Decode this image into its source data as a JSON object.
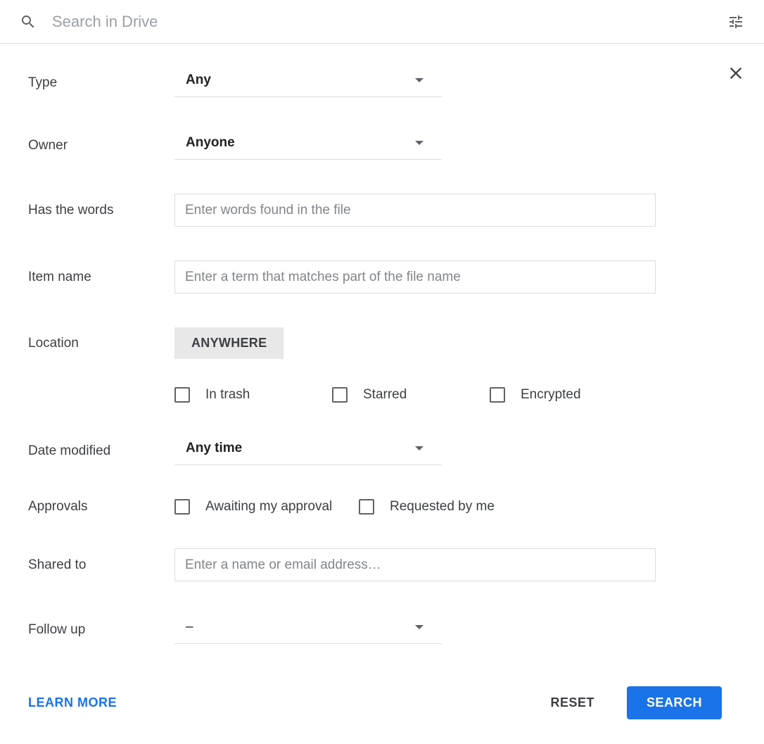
{
  "search": {
    "placeholder": "Search in Drive"
  },
  "form": {
    "type": {
      "label": "Type",
      "value": "Any"
    },
    "owner": {
      "label": "Owner",
      "value": "Anyone"
    },
    "hasWords": {
      "label": "Has the words",
      "placeholder": "Enter words found in the file"
    },
    "itemName": {
      "label": "Item name",
      "placeholder": "Enter a term that matches part of the file name"
    },
    "location": {
      "label": "Location",
      "chip": "ANYWHERE"
    },
    "locationChecks": {
      "inTrash": "In trash",
      "starred": "Starred",
      "encrypted": "Encrypted"
    },
    "dateModified": {
      "label": "Date modified",
      "value": "Any time"
    },
    "approvals": {
      "label": "Approvals",
      "awaiting": "Awaiting my approval",
      "requested": "Requested by me"
    },
    "sharedTo": {
      "label": "Shared to",
      "placeholder": "Enter a name or email address…"
    },
    "followUp": {
      "label": "Follow up",
      "value": "–"
    }
  },
  "footer": {
    "learnMore": "LEARN MORE",
    "reset": "RESET",
    "search": "SEARCH"
  }
}
